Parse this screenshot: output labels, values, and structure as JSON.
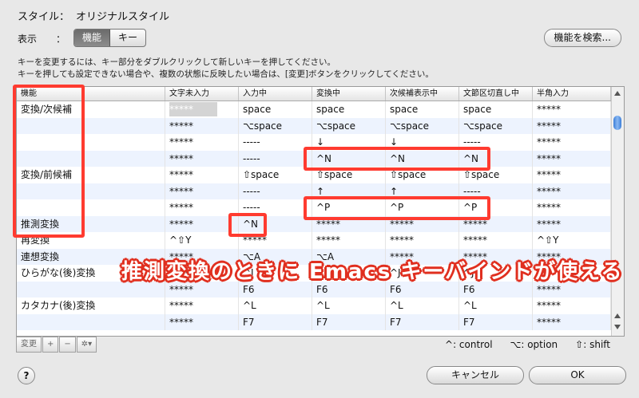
{
  "style": {
    "label": "スタイル：",
    "value": "オリジナルスタイル"
  },
  "view": {
    "label": "表示",
    "colon": "：",
    "tabs": [
      "機能",
      "キー"
    ],
    "selected": "機能"
  },
  "search_button": "機能を検索...",
  "instructions": [
    "キーを変更するには、キー部分をダブルクリックして新しいキーを押してください。",
    "キーを押しても設定できない場合や、複数の状態に反映したい場合は、[変更]ボタンをクリックしてください。"
  ],
  "table": {
    "headers": [
      "機能",
      "文字未入力",
      "入力中",
      "変換中",
      "次候補表示中",
      "文節区切直し中",
      "半角入力"
    ],
    "rows": [
      [
        "変換/次候補",
        "*****",
        "space",
        "space",
        "space",
        "space",
        "*****"
      ],
      [
        "",
        "*****",
        "⌥space",
        "⌥space",
        "⌥space",
        "⌥space",
        "*****"
      ],
      [
        "",
        "*****",
        "-----",
        "↓",
        "↓",
        "-----",
        "*****"
      ],
      [
        "",
        "*****",
        "-----",
        "^N",
        "^N",
        "^N",
        "*****"
      ],
      [
        "変換/前候補",
        "*****",
        "⇧space",
        "⇧space",
        "⇧space",
        "⇧space",
        "*****"
      ],
      [
        "",
        "*****",
        "-----",
        "↑",
        "↑",
        "-----",
        "*****"
      ],
      [
        "",
        "*****",
        "-----",
        "^P",
        "^P",
        "^P",
        "*****"
      ],
      [
        "推測変換",
        "*****",
        "^N",
        "*****",
        "*****",
        "*****",
        "*****"
      ],
      [
        "再変換",
        "^⇧Y",
        "*****",
        "*****",
        "*****",
        "*****",
        "^⇧Y"
      ],
      [
        "連想変換",
        "*****",
        "⌥A",
        "⌥A",
        "*****",
        "*****",
        "*****"
      ],
      [
        "ひらがな(後)変換",
        "*****",
        "^J",
        "^J",
        "^J",
        "^J",
        "*****"
      ],
      [
        "",
        "*****",
        "F6",
        "F6",
        "F6",
        "F6",
        "*****"
      ],
      [
        "カタカナ(後)変換",
        "*****",
        "^L",
        "^L",
        "^L",
        "^L",
        "*****"
      ],
      [
        "",
        "*****",
        "F7",
        "F7",
        "F7",
        "F7",
        "*****"
      ]
    ]
  },
  "bottom_bar": {
    "change": "変更",
    "add": "+",
    "remove": "−",
    "gear": "✲▾"
  },
  "legend": [
    "^: control",
    "⌥: option",
    "⇧: shift"
  ],
  "help": "?",
  "buttons": {
    "cancel": "キャンセル",
    "ok": "OK"
  },
  "annotation": "推測変換のときに Emacs キーバインドが使える",
  "colors": {
    "highlight": "#ff3b30",
    "selected_segment": "#6b6b6b",
    "scroll_thumb": "#3d7fd9"
  }
}
